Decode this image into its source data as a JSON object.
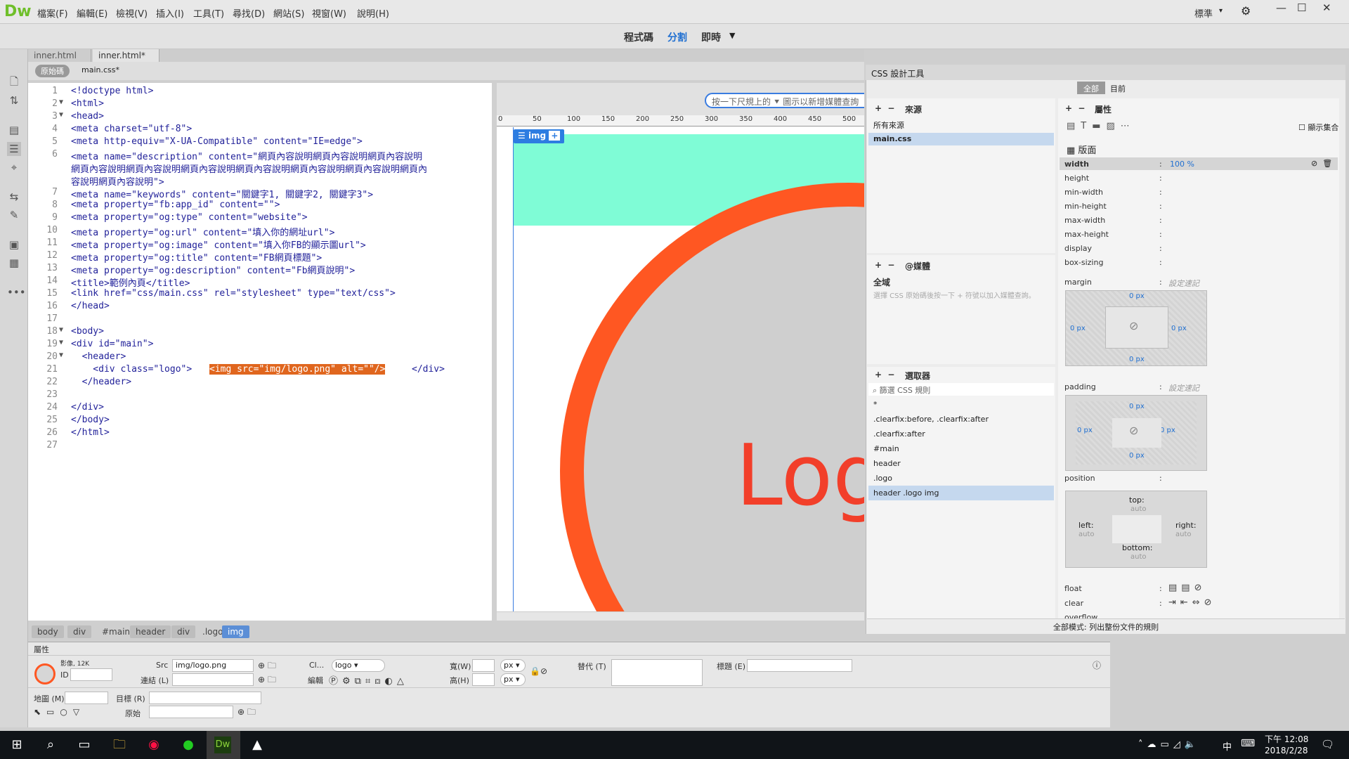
{
  "app": {
    "logo": "Dw",
    "menus": [
      "檔案(F)",
      "編輯(E)",
      "檢視(V)",
      "插入(I)",
      "工具(T)",
      "尋找(D)",
      "網站(S)",
      "視窗(W)",
      "說明(H)"
    ],
    "workspace": "標準",
    "gear": "⚙"
  },
  "view_modes": [
    "程式碼",
    "分割",
    "即時"
  ],
  "tabs": [
    "inner.html",
    "inner.html*"
  ],
  "subbar": {
    "source": "原始碼",
    "css": "main.css*"
  },
  "code_lines": [
    {
      "n": "1",
      "f": "",
      "t": "<!doctype html>"
    },
    {
      "n": "2",
      "f": "▼",
      "t": "<html>"
    },
    {
      "n": "3",
      "f": "▼",
      "t": "<head>"
    },
    {
      "n": "4",
      "f": "",
      "t": "<meta charset=\"utf-8\">"
    },
    {
      "n": "5",
      "f": "",
      "t": "<meta http-equiv=\"X-UA-Compatible\" content=\"IE=edge\">"
    },
    {
      "n": "6",
      "f": "",
      "t": "<meta name=\"description\" content=\"網頁內容說明網頁內容說明網頁內容說明"
    },
    {
      "n": "",
      "f": "",
      "t": "網頁內容說明網頁內容說明網頁內容說明網頁內容說明網頁內容說明網頁內容說明網頁內"
    },
    {
      "n": "",
      "f": "",
      "t": "容說明網頁內容說明\">"
    },
    {
      "n": "7",
      "f": "",
      "t": "<meta name=\"keywords\" content=\"關鍵字1, 關鍵字2, 關鍵字3\">"
    },
    {
      "n": "8",
      "f": "",
      "t": "<meta property=\"fb:app_id\" content=\"\">"
    },
    {
      "n": "9",
      "f": "",
      "t": "<meta property=\"og:type\" content=\"website\">"
    },
    {
      "n": "10",
      "f": "",
      "t": "<meta property=\"og:url\" content=\"填入你的網址url\">"
    },
    {
      "n": "11",
      "f": "",
      "t": "<meta property=\"og:image\" content=\"填入你FB的顯示圖url\">"
    },
    {
      "n": "12",
      "f": "",
      "t": "<meta property=\"og:title\" content=\"FB網頁標題\">"
    },
    {
      "n": "13",
      "f": "",
      "t": "<meta property=\"og:description\" content=\"Fb網頁說明\">"
    },
    {
      "n": "14",
      "f": "",
      "t": "<title>範例內頁</title>"
    },
    {
      "n": "15",
      "f": "",
      "t": "<link href=\"css/main.css\" rel=\"stylesheet\" type=\"text/css\">"
    },
    {
      "n": "16",
      "f": "",
      "t": "</head>"
    },
    {
      "n": "17",
      "f": "",
      "t": ""
    },
    {
      "n": "18",
      "f": "▼",
      "t": "<body>"
    },
    {
      "n": "19",
      "f": "▼",
      "t": "<div id=\"main\">"
    },
    {
      "n": "20",
      "f": "▼",
      "t": "  <header>"
    },
    {
      "n": "21",
      "f": "",
      "t": "    <div class=\"logo\">"
    },
    {
      "n": "22",
      "f": "",
      "t": "  </header>"
    },
    {
      "n": "23",
      "f": "",
      "t": ""
    },
    {
      "n": "24",
      "f": "",
      "t": "</div>"
    },
    {
      "n": "25",
      "f": "",
      "t": "</body>"
    },
    {
      "n": "26",
      "f": "",
      "t": "</html>"
    },
    {
      "n": "27",
      "f": "",
      "t": ""
    }
  ],
  "code_highlight": "<img src=\"img/logo.png\" alt=\"\"/>",
  "code_after": "</div>",
  "design": {
    "hint": "按一下尺規上的",
    "hint2": "圖示以新增媒體查詢",
    "ruler": [
      "0",
      "50",
      "100",
      "150",
      "200",
      "250",
      "300",
      "350",
      "400",
      "450",
      "500"
    ],
    "img_tag": "img",
    "logo_text": "Log"
  },
  "css_designer": {
    "title": "CSS 設計工具",
    "tab_all": "全部",
    "tab_current": "目前",
    "sources_title": "來源",
    "sources": [
      "所有來源",
      "main.css"
    ],
    "media_title": "@媒體",
    "media_global": "全域",
    "media_hint": "選擇 CSS 原始碼後按一下 + 符號以加入媒體查詢。",
    "selectors_title": "選取器",
    "filter_placeholder": "篩選 CSS 規則",
    "selectors": [
      "*",
      ".clearfix:before, .clearfix:after",
      ".clearfix:after",
      "#main",
      "header",
      ".logo",
      "header .logo img"
    ],
    "props_title": "屬性",
    "show_set": "顯示集合",
    "layout": "版面",
    "width_val": "100",
    "width_unit": "%",
    "props": [
      "width",
      "height",
      "min-width",
      "min-height",
      "max-width",
      "max-height",
      "display",
      "box-sizing"
    ],
    "margin": "margin",
    "padding": "padding",
    "set_shorthand": "設定速記",
    "zero_px": "0 px",
    "position": "position",
    "top": "top:",
    "left": "left:",
    "right": "right:",
    "bottom": "bottom:",
    "auto": "auto",
    "float": "float",
    "clear": "clear",
    "overflow": "overflow",
    "footer": "全部模式: 列出整份文件的規則"
  },
  "breadcrumb": [
    "body",
    "div",
    "#main",
    "header",
    "div",
    ".logo",
    "img"
  ],
  "properties": {
    "title": "屬性",
    "image_label": "影像, 12K",
    "id": "ID",
    "src_label": "Src",
    "src_val": "img/logo.png",
    "link": "連結 (L)",
    "class_label": "Cl...",
    "class_val": "logo",
    "edit": "編輯",
    "width": "寬(W)",
    "height": "高(H)",
    "unit": "px",
    "alt": "替代 (T)",
    "title_label": "標題 (E)",
    "map": "地圖 (M)",
    "target": "目標 (R)",
    "original": "原始"
  },
  "taskbar": {
    "time": "下午 12:08",
    "date": "2018/2/28",
    "lang": "中"
  }
}
